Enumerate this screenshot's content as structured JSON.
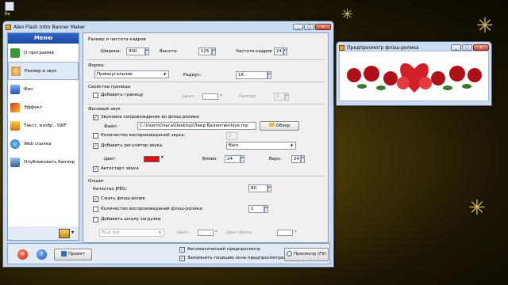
{
  "desktop": {
    "icons": [
      {
        "label": "Ко"
      },
      {
        "label": "Ко"
      }
    ]
  },
  "main_window": {
    "title": "Aleo Flash Intro Banner Maker",
    "sidebar": {
      "title": "Меню",
      "items": [
        {
          "label": "О программе",
          "icon": "home-icon"
        },
        {
          "label": "Размер и звук",
          "icon": "palette-icon"
        },
        {
          "label": "Фон",
          "icon": "background-icon"
        },
        {
          "label": "Эффект",
          "icon": "effect-icon"
        },
        {
          "label": "Текст, изобр., SWF",
          "icon": "text-image-icon"
        },
        {
          "label": "Web ссылка",
          "icon": "web-link-icon"
        },
        {
          "label": "Опубликовать баннер",
          "icon": "publish-icon"
        }
      ]
    },
    "size": {
      "heading": "Размер и частота кадров",
      "width_label": "Ширина:",
      "width": "400",
      "height_label": "Высота:",
      "height": "125",
      "fps_label": "Частота кадров",
      "fps": "24"
    },
    "shape": {
      "label": "Форма:",
      "value": "Прямоугольник",
      "radius_label": "Радиус:",
      "radius": "16"
    },
    "border": {
      "heading": "Свойства границы",
      "add_label": "Добавить границу",
      "color_label": "Цвет:",
      "size_label": "Размер:",
      "size": "2"
    },
    "sound": {
      "heading": "Фоновый звук",
      "enable_label": "Звуковое сопровождение во флэш-ролике",
      "file_label": "Файл:",
      "file": "C:\\Users\\Ольга\\Desktop\\Леер Валентин\\love.mp",
      "browse_label": "Обзор",
      "repeat_label": "Количество воспроизведений звука:",
      "repeat": "2",
      "regulator_label": "Добавить регулятор звука",
      "regulator_style": "Bars",
      "color_label": "Цвет:",
      "left_label": "Влево:",
      "left": "24",
      "top_label": "Верх:",
      "top": "24",
      "autostart_label": "Автостарт звука"
    },
    "options": {
      "heading": "Опции",
      "jpeg_label": "Качество JPEG:",
      "jpeg": "80",
      "compress_label": "Сжать флэш-ролик",
      "repeat_label": "Количество воспроизведений флэш-ролика:",
      "repeat": "1",
      "loadbar_label": "Добавить шкалу загрузки",
      "loadbar_style": "Blue bar",
      "color_label": "Цвет:",
      "bgcolor_label": "Цвет фона:"
    },
    "bottom": {
      "project_label": "Проект",
      "auto_preview_label": "Автоматический предпросмотр",
      "remember_pos_label": "Запомнить позицию окна предпросмотра",
      "preview_label": "Просмотр (F9)"
    },
    "colors": {
      "sound_regulator": "#e01010",
      "accent": "#1c49a0"
    }
  },
  "preview_window": {
    "title": "Предпросмотр флэш-ролика"
  }
}
